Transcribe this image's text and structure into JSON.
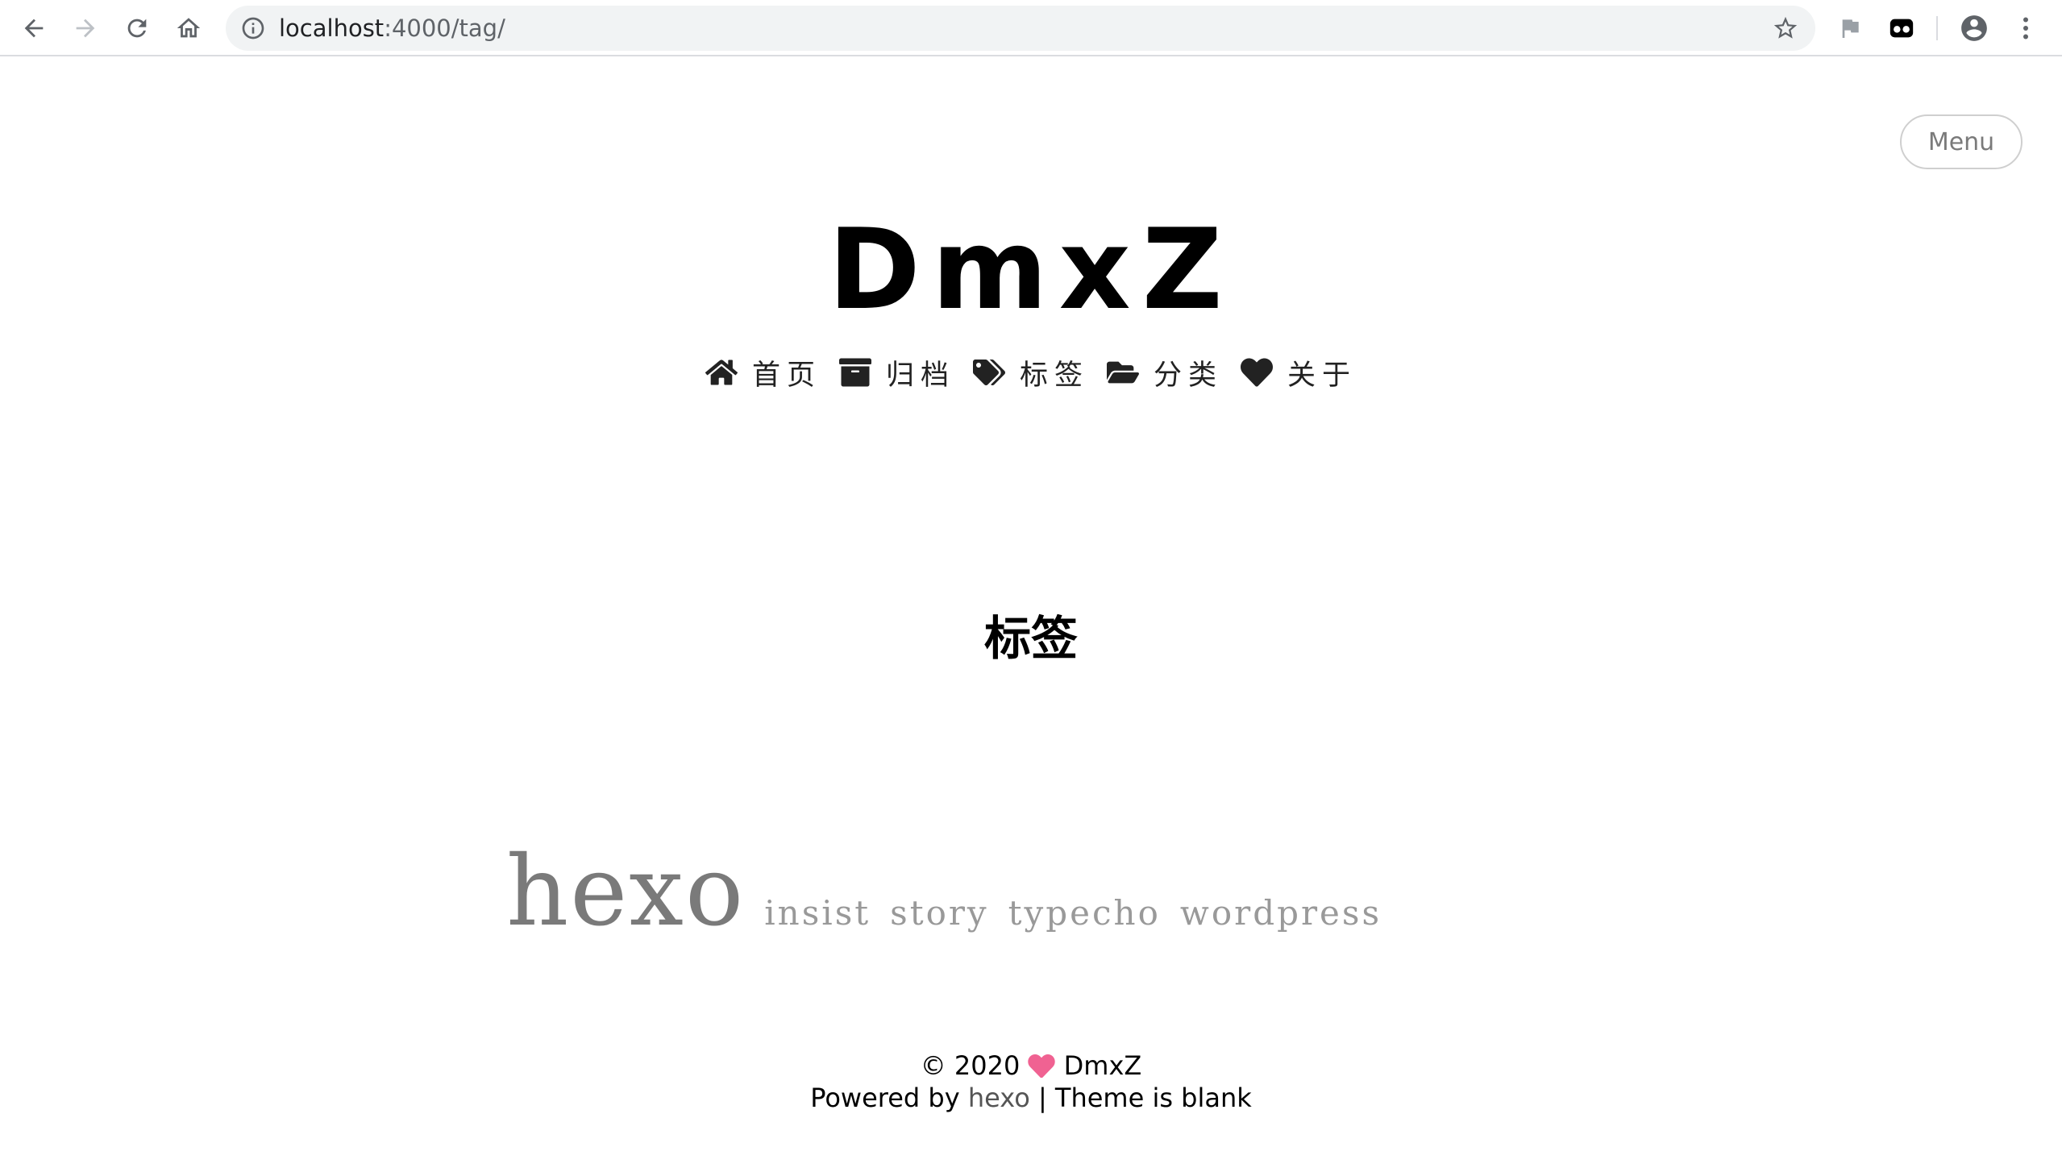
{
  "browser": {
    "url_host": "localhost",
    "url_path": ":4000/tag/"
  },
  "page": {
    "menu_label": "Menu",
    "site_title": "DmxZ",
    "nav": [
      {
        "icon": "home-icon",
        "label": "首页"
      },
      {
        "icon": "archive-icon",
        "label": "归档"
      },
      {
        "icon": "tags-icon",
        "label": "标签"
      },
      {
        "icon": "folder-open-icon",
        "label": "分类"
      },
      {
        "icon": "heart-icon",
        "label": "关于"
      }
    ],
    "heading": "标签",
    "tags": [
      {
        "name": "hexo",
        "size": "large"
      },
      {
        "name": "insist",
        "size": "small"
      },
      {
        "name": "story",
        "size": "small"
      },
      {
        "name": "typecho",
        "size": "small"
      },
      {
        "name": "wordpress",
        "size": "small"
      }
    ]
  },
  "footer": {
    "copyright_prefix": "© 2020",
    "author": "DmxZ",
    "powered_prefix": "Powered by",
    "powered_link": "hexo",
    "theme_text": "| Theme is blank",
    "heart_color": "#f06292"
  }
}
